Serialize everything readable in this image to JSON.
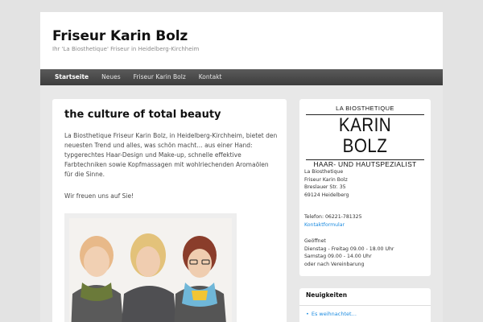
{
  "site": {
    "title": "Friseur Karin Bolz",
    "description": "Ihr 'La Biosthetique' Friseur in Heidelberg-Kirchheim"
  },
  "nav": {
    "items": [
      {
        "label": "Startseite",
        "active": true
      },
      {
        "label": "Neues",
        "active": false
      },
      {
        "label": "Friseur Karin Bolz",
        "active": false
      },
      {
        "label": "Kontakt",
        "active": false
      }
    ]
  },
  "main": {
    "title": "the culture of total beauty",
    "paragraph1": "La Biosthetique Friseur Karin Bolz, in Heidelberg-Kirchheim, bietet den neuesten Trend und alles, was schön macht… aus einer Hand: typgerechtes Haar-Design und Make-up, schnelle effektive Farbtechniken sowie Kopfmassagen mit wohlriechenden Aromaölen für die Sinne.",
    "paragraph2": "Wir freuen uns auf Sie!"
  },
  "sidebar": {
    "logo": {
      "top": "LA BIOSTHETIQUE",
      "name": "KARIN BOLZ",
      "subtitle": "HAAR- UND HAUTSPEZIALIST"
    },
    "address": [
      "La Biosthetique",
      "Friseur Karin Bolz",
      "Breslauer Str. 35",
      "69124 Heidelberg"
    ],
    "phone": "Telefon: 06221-781325",
    "contact_link": "Kontaktformular",
    "hours_label": "Geöffnet",
    "hours": [
      "Dienstag - Freitag 09.00 - 18.00 Uhr",
      "Samstag 09.00 - 14.00 Uhr",
      "oder nach Vereinbarung"
    ]
  },
  "news": {
    "title": "Neuigkeiten",
    "items": [
      "Es weihnachtet…"
    ]
  },
  "colors": {
    "link": "#1b8be0",
    "nav_bg": "#444444",
    "page_bg": "#e3e3e3"
  }
}
